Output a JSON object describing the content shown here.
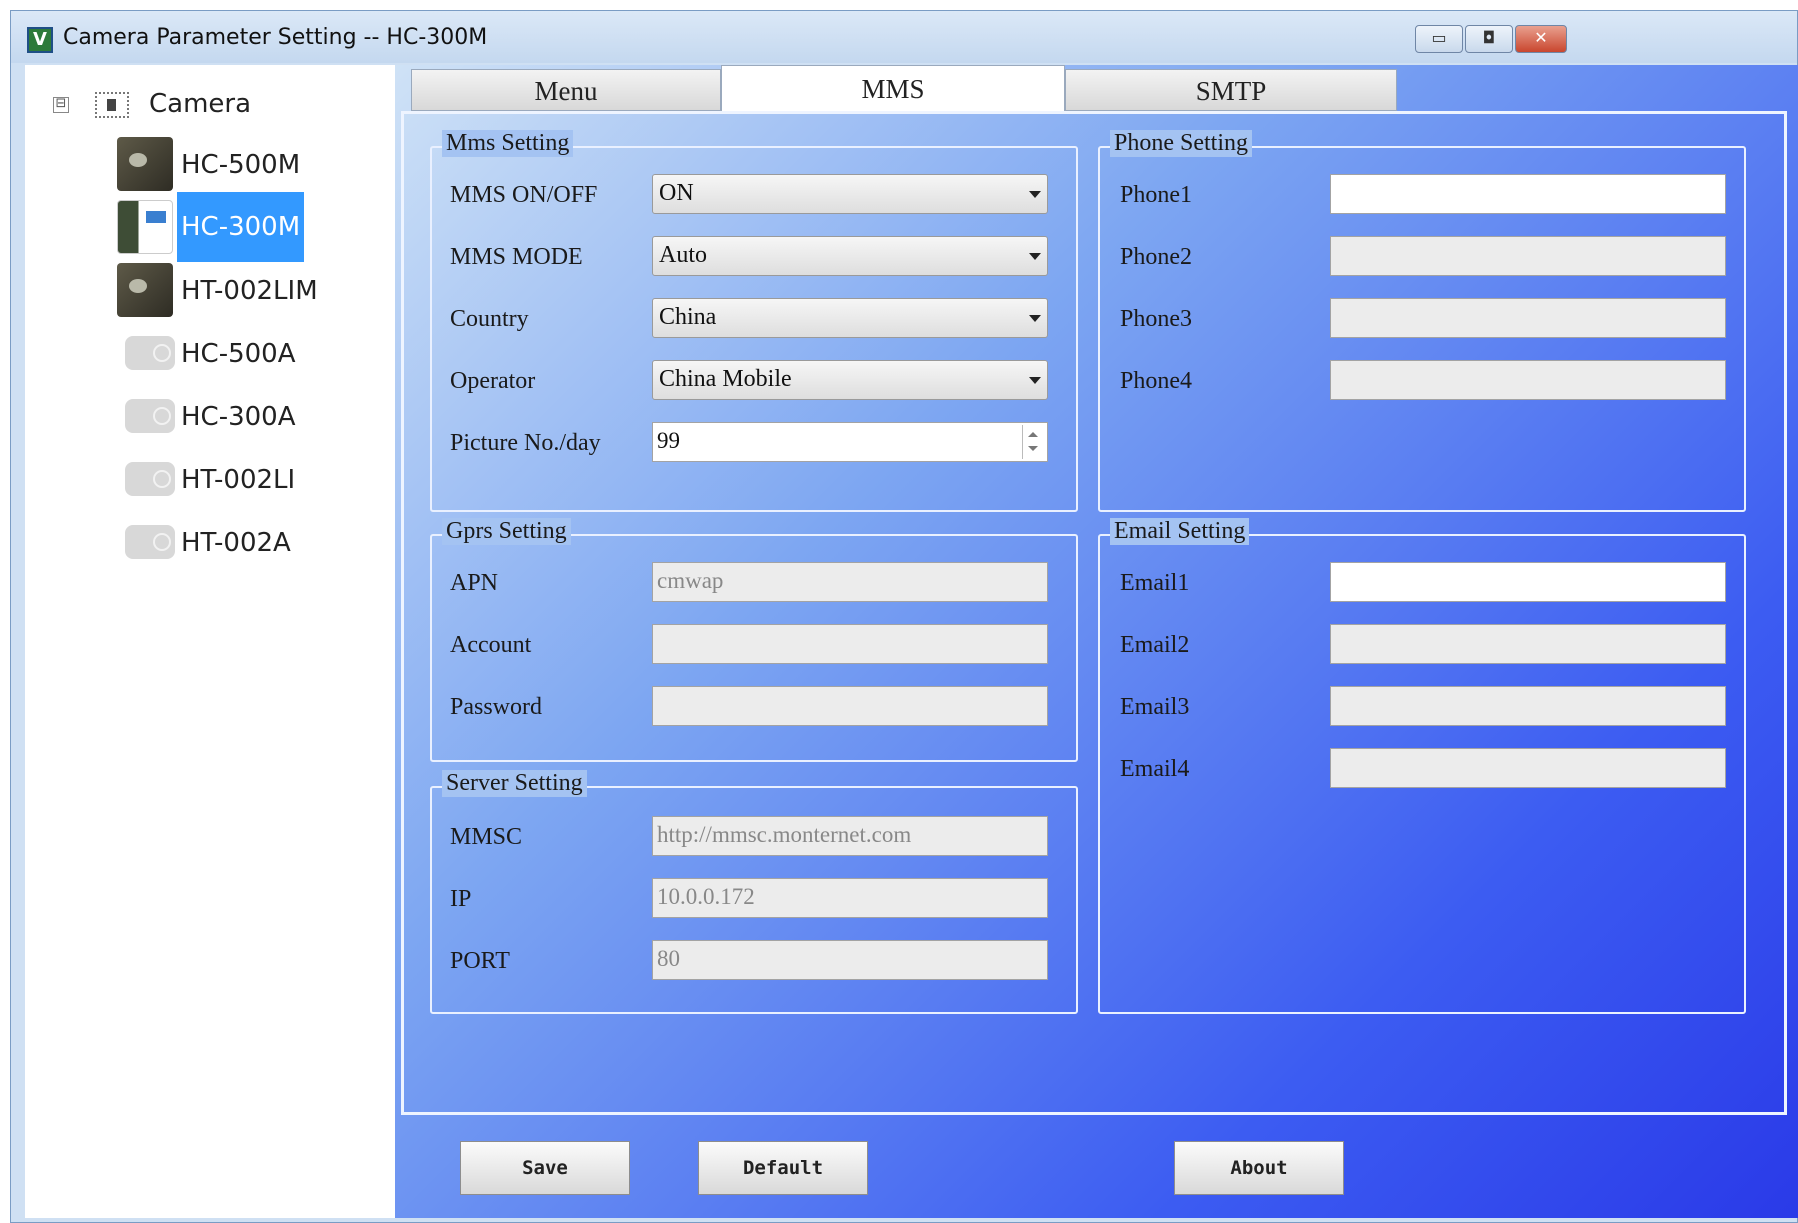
{
  "window": {
    "icon_glyph": "V",
    "title": "Camera Parameter Setting -- HC-300M",
    "min_glyph": "▭",
    "max_glyph": "◘",
    "close_glyph": "✕"
  },
  "tree": {
    "expander": "⊟",
    "root_label": "Camera",
    "items": [
      {
        "label": "HC-500M",
        "icon": "camera-thumbnail"
      },
      {
        "label": "HC-300M",
        "icon": "camera-package-thumbnail",
        "selected": true
      },
      {
        "label": "HT-002LIM",
        "icon": "camera-thumbnail"
      },
      {
        "label": "HC-500A",
        "icon": "camera-placeholder-icon"
      },
      {
        "label": "HC-300A",
        "icon": "camera-placeholder-icon"
      },
      {
        "label": "HT-002LI",
        "icon": "camera-placeholder-icon"
      },
      {
        "label": "HT-002A",
        "icon": "camera-placeholder-icon"
      }
    ]
  },
  "tabs": {
    "menu": "Menu",
    "mms": "MMS",
    "smtp": "SMTP",
    "active": "MMS"
  },
  "mms_setting": {
    "title": "Mms Setting",
    "mms_onoff_label": "MMS ON/OFF",
    "mms_onoff_value": "ON",
    "mms_mode_label": "MMS MODE",
    "mms_mode_value": "Auto",
    "country_label": "Country",
    "country_value": "China",
    "operator_label": "Operator",
    "operator_value": "China Mobile",
    "picture_label": "Picture No./day",
    "picture_value": "99"
  },
  "gprs_setting": {
    "title": "Gprs Setting",
    "apn_label": "APN",
    "apn_value": "cmwap",
    "account_label": "Account",
    "account_value": "",
    "password_label": "Password",
    "password_value": ""
  },
  "server_setting": {
    "title": "Server Setting",
    "mmsc_label": "MMSC",
    "mmsc_value": "http://mmsc.monternet.com",
    "ip_label": "IP",
    "ip_value": "10.0.0.172",
    "port_label": "PORT",
    "port_value": "80"
  },
  "phone_setting": {
    "title": "Phone Setting",
    "phone1_label": "Phone1",
    "phone2_label": "Phone2",
    "phone3_label": "Phone3",
    "phone4_label": "Phone4",
    "phone1_value": "",
    "phone2_value": "",
    "phone3_value": "",
    "phone4_value": ""
  },
  "email_setting": {
    "title": "Email Setting",
    "email1_label": "Email1",
    "email2_label": "Email2",
    "email3_label": "Email3",
    "email4_label": "Email4",
    "email1_value": "",
    "email2_value": "",
    "email3_value": "",
    "email4_value": ""
  },
  "buttons": {
    "save": "Save",
    "default": "Default",
    "about": "About"
  },
  "colors": {
    "selection": "#3399ff",
    "background_gradient_end": "#2a3ae8"
  }
}
